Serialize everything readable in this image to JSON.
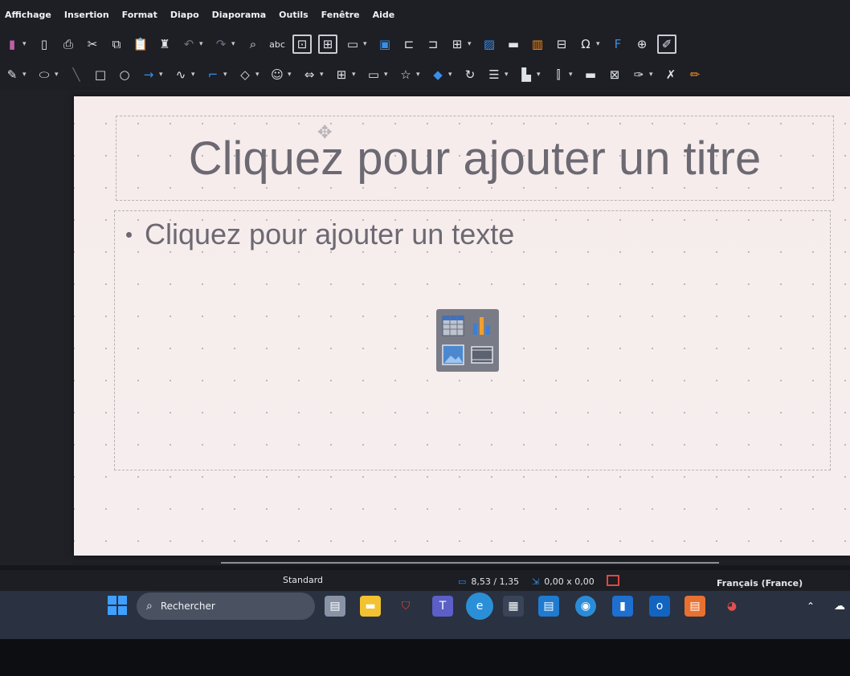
{
  "menu": [
    "Affichage",
    "Insertion",
    "Format",
    "Diapo",
    "Diaporama",
    "Outils",
    "Fenêtre",
    "Aide"
  ],
  "toolbar": {
    "spellcheck_label": "abc"
  },
  "slide": {
    "title_placeholder": "Cliquez pour ajouter un titre",
    "content_placeholder": "Cliquez pour ajouter un texte"
  },
  "status": {
    "layout": "Standard",
    "position": "8,53 / 1,35",
    "size": "0,00 x 0,00",
    "language": "Français (France)"
  },
  "taskbar": {
    "search_placeholder": "Rechercher"
  },
  "colors": {
    "slide_text": "#6c6972",
    "accent_blue": "#3a8ee6",
    "accent_red": "#e0483f"
  }
}
